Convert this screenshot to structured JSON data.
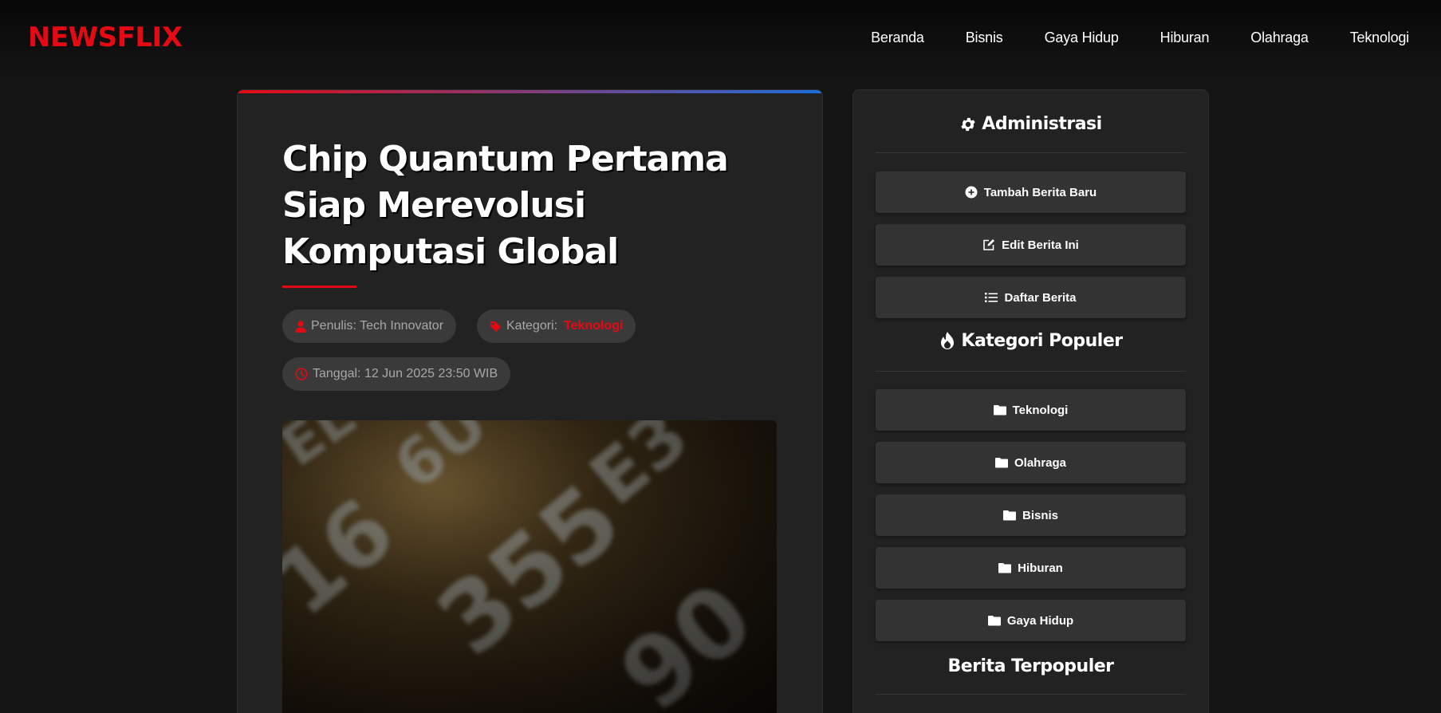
{
  "header": {
    "brand": "NEWSFLIX",
    "nav": [
      "Beranda",
      "Bisnis",
      "Gaya Hidup",
      "Hiburan",
      "Olahraga",
      "Teknologi"
    ]
  },
  "article": {
    "title": "Chip Quantum Pertama Siap Merevolusi Komputasi Global",
    "author": "Penulis: Tech Innovator",
    "category_label": "Kategori:",
    "category_value": "Teknologi",
    "date": "Tanggal: 12 Jun 2025 23:50 WIB"
  },
  "sidebar": {
    "admin_heading": "Administrasi",
    "admin_buttons": [
      "Tambah Berita Baru",
      "Edit Berita Ini",
      "Daftar Berita"
    ],
    "categories_heading": "Kategori Populer",
    "categories": [
      "Teknologi",
      "Olahraga",
      "Bisnis",
      "Hiburan",
      "Gaya Hidup"
    ],
    "popular_heading": "Berita Terpopuler"
  },
  "colors": {
    "accent": "#e50914",
    "background": "#141414",
    "card": "#222222",
    "button": "#333333"
  },
  "icons": {
    "admin": "gear-icon",
    "add": "plus-circle-icon",
    "edit": "edit-icon",
    "list": "list-icon",
    "popular": "fire-icon",
    "category": "folder-icon",
    "author": "user-icon",
    "category_meta": "tag-icon",
    "date": "clock-icon"
  }
}
